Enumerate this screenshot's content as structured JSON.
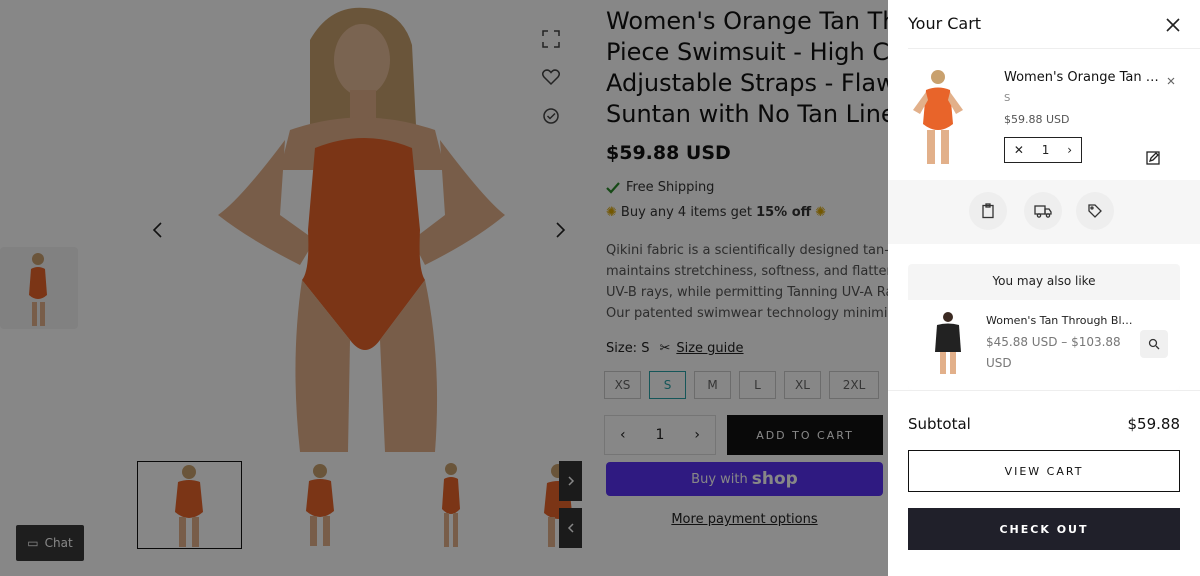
{
  "product": {
    "title": "Women's Orange Tan Through One Piece Swimsuit - High Cut Adjustable Straps - Flawless Suntan with No Tan Lines",
    "title_lines": [
      "Women's Orange Tan Th",
      "Piece Swimsuit - High Cu",
      "Adjustable Straps - Flaw",
      "Suntan with No Tan Lines"
    ],
    "price": "$59.88 USD",
    "shipping": "Free Shipping",
    "promo_prefix": "Buy any 4 items get ",
    "promo_bold": "15% off",
    "description_lines": [
      "Qikini fabric is a scientifically designed tan-th",
      "maintains stretchiness, softness, and flattery.",
      "UV-B rays, while permitting Tanning UV-A Ray",
      "Our patented swimwear technology minimize"
    ],
    "size_label": "Size: S",
    "size_guide": "Size guide",
    "sizes": [
      "XS",
      "S",
      "M",
      "L",
      "XL",
      "2XL"
    ],
    "selected_size": "S",
    "quantity": "1",
    "add_to_cart": "ADD TO CART",
    "buy_with": "Buy with",
    "shop_brand": "shop",
    "more_payment": "More payment options",
    "chat_label": "Chat"
  },
  "cart": {
    "title": "Your Cart",
    "item": {
      "name": "Women's Orange Tan Through One Piece Swimsuit",
      "variant": "S",
      "price": "$59.88 USD",
      "quantity": "1"
    },
    "recommend": {
      "title": "You may also like",
      "name": "Women's Tan Through Black Tee",
      "price": "$45.88 USD – $103.88 USD"
    },
    "subtotal_label": "Subtotal",
    "subtotal_value": "$59.88",
    "view_cart": "VIEW CART",
    "checkout": "CHECK OUT"
  },
  "colors": {
    "swimsuit": "#e8642a",
    "accent_teal": "#2aa3a8",
    "shop_purple": "#5a31f4",
    "checkout_dark": "#20202a"
  }
}
